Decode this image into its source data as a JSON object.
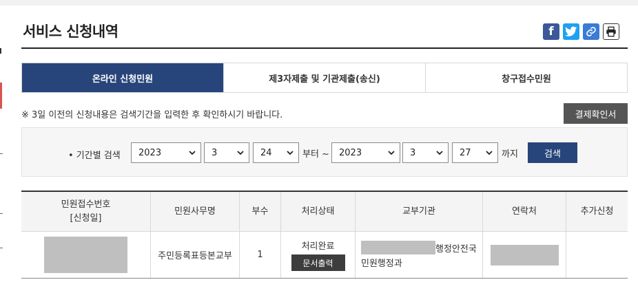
{
  "page": {
    "title": "서비스 신청내역"
  },
  "share": {
    "facebook_glyph": "f"
  },
  "tabs": [
    {
      "label": "온라인 신청민원",
      "active": true
    },
    {
      "label": "제3자제출 및 기관제출(송신)",
      "active": false
    },
    {
      "label": "창구접수민원",
      "active": false
    }
  ],
  "notice": "※ 3일 이전의 신청내용은 검색기간을 입력한 후 확인하시기 바랍니다.",
  "confirm_button": "결제확인서",
  "search": {
    "label": "• 기간별 검색",
    "from": {
      "year": "2023",
      "month": "3",
      "day": "24"
    },
    "from_suffix": "부터 ~",
    "to": {
      "year": "2023",
      "month": "3",
      "day": "27"
    },
    "to_suffix": "까지",
    "button": "검색"
  },
  "table": {
    "headers": {
      "receipt_no": "민원접수번호",
      "receipt_date": "[신청일]",
      "affair": "민원사무명",
      "copies": "부수",
      "status": "처리상태",
      "agency": "교부기관",
      "contact": "연락처",
      "extra": "추가신청"
    },
    "rows": [
      {
        "affair": "주민등록표등본교부",
        "copies": "1",
        "status": "처리완료",
        "doc_button": "문서출력",
        "agency_line1": "행정안전국",
        "agency_line2": "민원행정과"
      }
    ]
  },
  "colors": {
    "accent": "#27457a",
    "facebook": "#3b5998",
    "twitter": "#1da1f2",
    "link": "#3a7bd5",
    "button_dark": "#555555"
  },
  "icons": [
    "facebook-icon",
    "twitter-icon",
    "link-icon",
    "print-icon",
    "chevron-down-icon"
  ]
}
